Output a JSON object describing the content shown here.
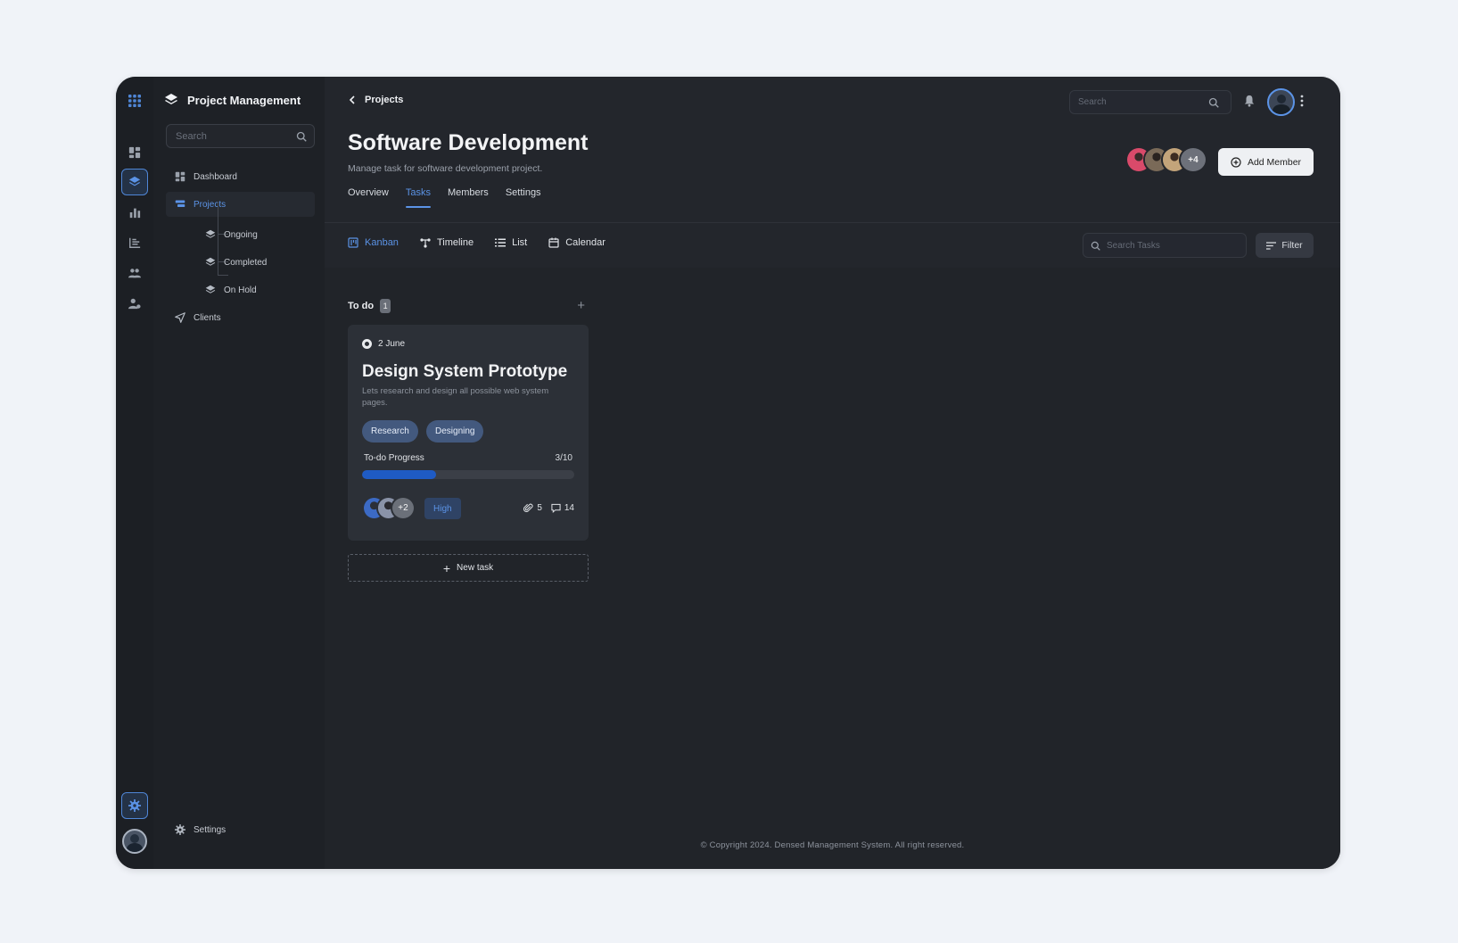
{
  "app": {
    "brand": "Project Management"
  },
  "sidebar": {
    "search_placeholder": "Search",
    "items": [
      {
        "label": "Dashboard",
        "icon": "dashboard-icon"
      },
      {
        "label": "Projects",
        "icon": "projects-icon",
        "active": true
      },
      {
        "label": "Clients",
        "icon": "send-icon"
      }
    ],
    "sub_items": [
      {
        "label": "Ongoing",
        "icon": "layers-icon"
      },
      {
        "label": "Completed",
        "icon": "layers-icon"
      },
      {
        "label": "On Hold",
        "icon": "layers-icon"
      }
    ],
    "settings_label": "Settings"
  },
  "header": {
    "back_label": "Projects",
    "search_placeholder": "Search",
    "title": "Software Development",
    "subtitle": "Manage task for software development project.",
    "members_more": "+4",
    "add_member_label": "Add Member"
  },
  "tabs": [
    {
      "label": "Overview"
    },
    {
      "label": "Tasks",
      "active": true
    },
    {
      "label": "Members"
    },
    {
      "label": "Settings"
    }
  ],
  "views": [
    {
      "label": "Kanban",
      "icon": "kanban-icon",
      "active": true
    },
    {
      "label": "Timeline",
      "icon": "timeline-icon"
    },
    {
      "label": "List",
      "icon": "list-icon"
    },
    {
      "label": "Calendar",
      "icon": "calendar-icon"
    }
  ],
  "toolbar": {
    "task_search_placeholder": "Search Tasks",
    "filter_label": "Filter"
  },
  "board": {
    "column": {
      "title": "To do",
      "count": "1",
      "add_symbol": "+"
    },
    "card": {
      "date": "2 June",
      "title": "Design System Prototype",
      "description": "Lets research and design all possible web system pages.",
      "tags": [
        "Research",
        "Designing"
      ],
      "progress_label": "To-do Progress",
      "progress_text": "3/10",
      "progress_fraction": 0.35,
      "assignees_more": "+2",
      "priority": "High",
      "attachments": "5",
      "comments": "14"
    },
    "new_task_label": "New task"
  },
  "footer": {
    "copyright": "© Copyright 2024. Densed Management System. All right reserved."
  },
  "colors": {
    "accent": "#5b93e6",
    "progress_fill": "#1f5bc4",
    "tag_bg": "#43597e",
    "priority_bg": "#2f4365"
  }
}
